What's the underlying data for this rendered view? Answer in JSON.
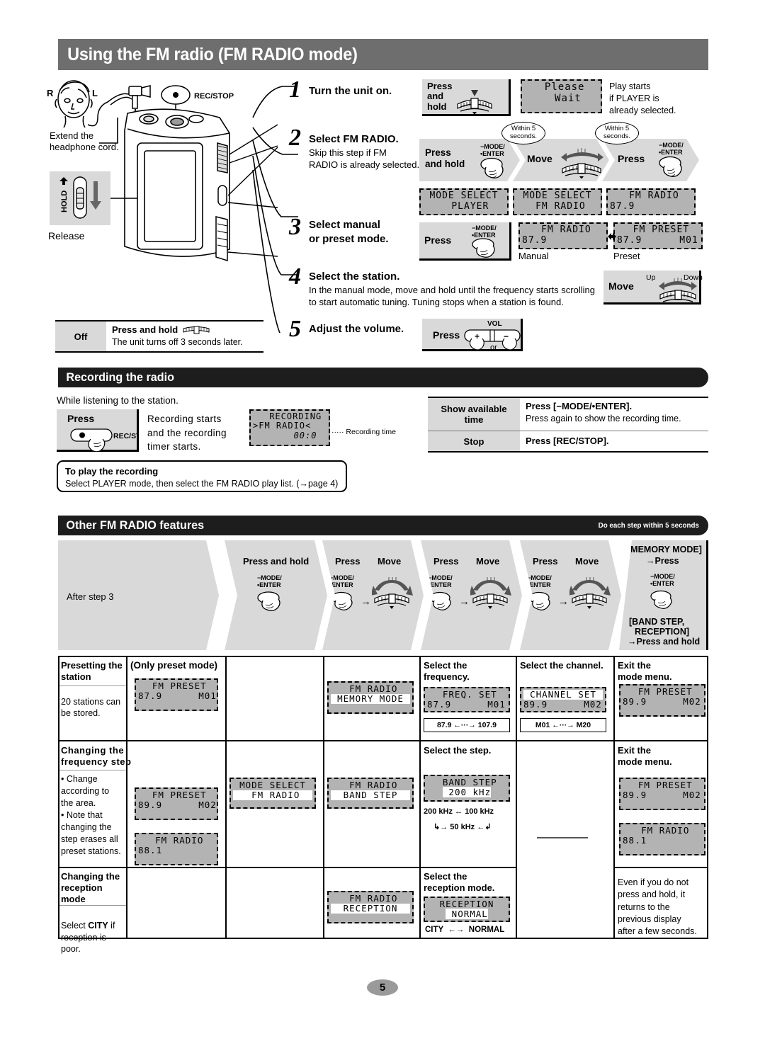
{
  "header": {
    "title": "Using the FM radio (FM RADIO mode)"
  },
  "illustration": {
    "channel_r": "R",
    "channel_l": "L",
    "rec_stop_label": "REC/STOP",
    "extend_cord": "Extend the\nheadphone cord.",
    "hold_label": "HOLD",
    "release_label": "Release"
  },
  "steps": [
    {
      "num": "1",
      "head": "Turn the unit on.",
      "body": ""
    },
    {
      "num": "2",
      "head": "Select FM RADIO.",
      "body": "Skip this step if FM\nRADIO is already selected."
    },
    {
      "num": "3",
      "head": "Select manual\nor preset mode.",
      "body": ""
    },
    {
      "num": "4",
      "head": "Select the station.",
      "body": "In the manual mode, move and hold until the frequency starts scrolling\nto start automatic tuning. Tuning stops when a station is found."
    },
    {
      "num": "5",
      "head": "Adjust the volume.",
      "body": ""
    }
  ],
  "actions": {
    "press_and_hold": "Press\nand\nhold",
    "press_and_hold_inline": "Press\nand hold",
    "press": "Press",
    "move": "Move",
    "mode_enter": "−MODE/\n•ENTER",
    "vol_label": "VOL",
    "vol_or": "or",
    "vol_plus": "+",
    "vol_minus": "−",
    "move_up": "Up",
    "move_down": "Down",
    "within5": "Within 5\nseconds."
  },
  "displays": {
    "please_wait": {
      "l1": " Please",
      "l2": "  Wait"
    },
    "mode_select_player": {
      "l1": "MODE SELECT",
      "l2": "  PLAYER"
    },
    "mode_select_fmradio": {
      "l1": "MODE SELECT",
      "l2": " FM RADIO"
    },
    "fm_radio_879": {
      "l1": " FM RADIO",
      "l2": "87.9"
    },
    "fm_radio_879_b": {
      "l1": " FM RADIO",
      "l2": "87.9"
    },
    "fm_preset_879_m01": {
      "l1": " FM PRESET",
      "l2": "87.9      M01"
    },
    "recording": {
      "l1": "  RECORDING",
      "l2": ">FM RADIO<",
      "l3": "       00:0"
    },
    "fm_preset_879_m01b": {
      "l1": " FM PRESET",
      "l2": "87.9      M01"
    },
    "fm_radio_memory": {
      "l1": " FM RADIO",
      "l2": "MEMORY MODE"
    },
    "freq_set": {
      "l1": " FREQ. SET",
      "l2": "87.9      M01"
    },
    "channel_set": {
      "l1": "CHANNEL SET",
      "l2": "89.9      M02"
    },
    "fm_preset_899_m02": {
      "l1": " FM PRESET",
      "l2": "89.9      M02"
    },
    "fm_preset_899_m02b": {
      "l1": " FM PRESET",
      "l2": "89.9      M02"
    },
    "fm_radio_881": {
      "l1": " FM RADIO",
      "l2": "88.1"
    },
    "fm_radio_881b": {
      "l1": " FM RADIO",
      "l2": "88.1"
    },
    "fm_radio_bandstep": {
      "l1": " FM RADIO",
      "l2": "BAND STEP"
    },
    "band_step_200": {
      "l1": " BAND STEP",
      "l2": " 200 kHz"
    },
    "fm_radio_reception": {
      "l1": " FM RADIO",
      "l2": "RECEPTION"
    },
    "reception_normal": {
      "l1": "RECEPTION",
      "l2": " NORMAL"
    }
  },
  "top_notes": {
    "play_starts": "Play starts\nif PLAYER is\nalready selected.",
    "manual": "Manual",
    "preset": "Preset"
  },
  "off_table": {
    "label": "Off",
    "line1": "Press and hold",
    "line2": "The unit turns off 3 seconds later."
  },
  "recording_section": {
    "title": "Recording the radio",
    "intro": "While listening to the station.",
    "press_label": "Press",
    "rec_stop": "REC/STOP",
    "desc": "Recording starts\nand the recording\ntimer starts.",
    "rec_time_caption": "Recording time",
    "table": [
      {
        "c1": "Show available\ntime",
        "c2_bold": "Press [−MODE/•ENTER].",
        "c2_plain": "Press again to show the recording time."
      },
      {
        "c1": "Stop",
        "c2_bold": "Press [REC/STOP].",
        "c2_plain": ""
      }
    ],
    "note_title": "To play the recording",
    "note_body": "Select PLAYER mode, then select the FM RADIO play list. (→page 4)"
  },
  "features_section": {
    "title": "Other FM RADIO features",
    "note": "Do each step within 5 seconds",
    "col_headers": [
      {
        "label": "After step 3"
      },
      {
        "label": "Press and hold"
      },
      {
        "label_a": "Press",
        "label_b": "Move"
      },
      {
        "label_a": "Press",
        "label_b": "Move"
      },
      {
        "label_a": "Press",
        "label_b": "Move"
      },
      {
        "l1": "[MEMORY MODE]",
        "l2": "→Press",
        "l3": "[BAND STEP,",
        "l4": "RECEPTION]",
        "l5": "→Press and hold"
      }
    ],
    "rows": [
      {
        "title": "Presetting the\nstation",
        "subtitle": "20 stations can\nbe stored.",
        "only_preset": "(Only preset mode)",
        "c4_head": "Select the\nfrequency.",
        "c5_head": "Select the channel.",
        "c6_head": "Exit the\nmode menu.",
        "freq_range": "87.9 ←···→ 107.9",
        "channel_range": "M01 ←···→ M20"
      },
      {
        "title": "Changing the\nfrequency step",
        "subtitle": "• Change\n   according to\n   the area.\n• Note that\n   changing the\n   step erases all\n   preset stations.",
        "c4_head": "Select the step.",
        "c6_head": "Exit the\nmode menu.",
        "step_range_1": "200 kHz ↔ 100 kHz",
        "step_range_2": "50 kHz"
      },
      {
        "title": "Changing the\nreception\nmode",
        "subtitle_pre": "Select ",
        "subtitle_bold": "CITY",
        "subtitle_post": " if\nreception is\npoor.",
        "c4_head": "Select the\nreception mode.",
        "reception_range_a": "CITY",
        "reception_range_b": "NORMAL",
        "c6_note": "Even if you do not\npress and hold, it\nreturns to the\nprevious display\nafter a few seconds."
      }
    ]
  },
  "page_number": "5",
  "colors": {
    "header_bar": "#6e6e6e",
    "section_bar": "#1d1d1d",
    "action_box": "#d9d9d9",
    "lcd": "#b3b3b3"
  }
}
